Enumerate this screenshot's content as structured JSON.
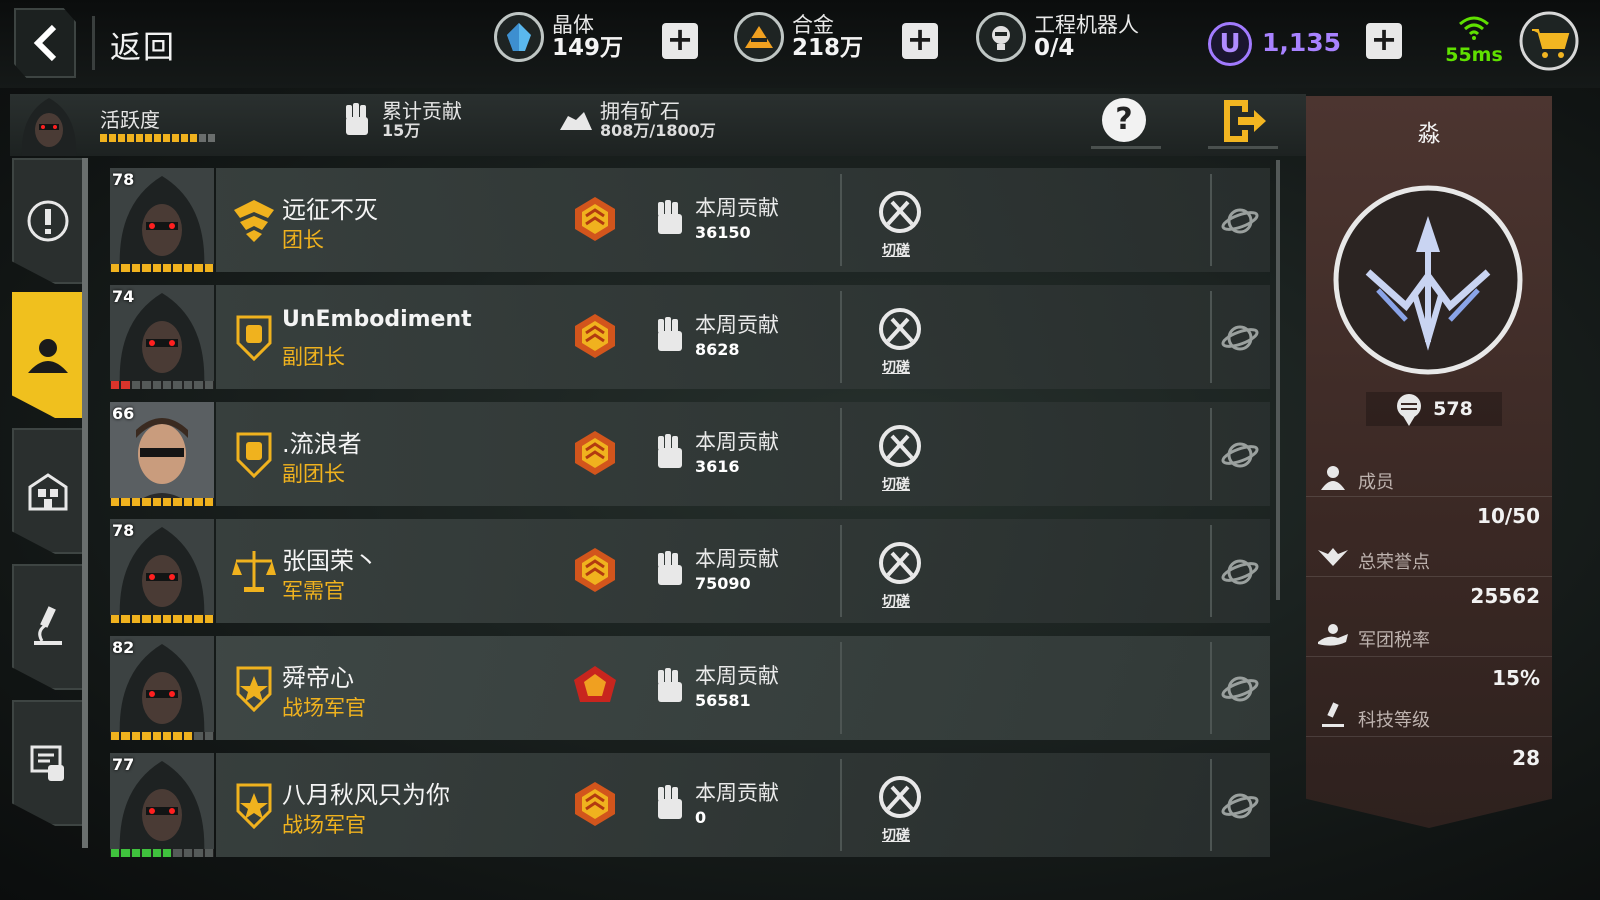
{
  "header": {
    "back_label": "返回",
    "resources": [
      {
        "name": "晶体",
        "value": "149万",
        "icon": "crystal-icon"
      },
      {
        "name": "合金",
        "value": "218万",
        "icon": "alloy-icon"
      },
      {
        "name": "工程机器人",
        "value": "0/4",
        "icon": "robot-icon"
      }
    ],
    "u_letter": "U",
    "u_value": "1,135",
    "ping": "55ms"
  },
  "infobar": {
    "activity_label": "活跃度",
    "contribution_label": "累计贡献",
    "contribution_value": "15万",
    "ore_label": "拥有矿石",
    "ore_value": "808万/1800万",
    "help_label": "?"
  },
  "members": [
    {
      "level": "78",
      "name": "远征不灭",
      "role": "团长",
      "week_label": "本周贡献",
      "week_value": "36150",
      "duel": "切磋",
      "has_duel": true,
      "bar": "full"
    },
    {
      "level": "74",
      "name": "UnEmbodiment",
      "role": "副团长",
      "week_label": "本周贡献",
      "week_value": "8628",
      "duel": "切磋",
      "has_duel": true,
      "bar": "red"
    },
    {
      "level": "66",
      "name": ".流浪者",
      "role": "副团长",
      "week_label": "本周贡献",
      "week_value": "3616",
      "duel": "切磋",
      "has_duel": true,
      "bar": "full"
    },
    {
      "level": "78",
      "name": "张国荣丶",
      "role": "军需官",
      "week_label": "本周贡献",
      "week_value": "75090",
      "duel": "切磋",
      "has_duel": true,
      "bar": "full"
    },
    {
      "level": "82",
      "name": "舜帝心",
      "role": "战场军官",
      "week_label": "本周贡献",
      "week_value": "56581",
      "duel": "",
      "has_duel": false,
      "bar": "partial"
    },
    {
      "level": "77",
      "name": "八月秋风只为你",
      "role": "战场军官",
      "week_label": "本周贡献",
      "week_value": "0",
      "duel": "切磋",
      "has_duel": true,
      "bar": "green"
    }
  ],
  "panel": {
    "title": "淼",
    "honor_value": "578",
    "stats": [
      {
        "label": "成员",
        "value": "10/50",
        "icon": "member-icon"
      },
      {
        "label": "总荣誉点",
        "value": "25562",
        "icon": "wings-icon"
      },
      {
        "label": "军团税率",
        "value": "15%",
        "icon": "tax-icon"
      },
      {
        "label": "科技等级",
        "value": "28",
        "icon": "microscope-icon"
      }
    ]
  },
  "colors": {
    "accent": "#f0b21e",
    "u_purple": "#a882ff",
    "ping_green": "#5fe000",
    "panel_brown": "#4c3530"
  }
}
